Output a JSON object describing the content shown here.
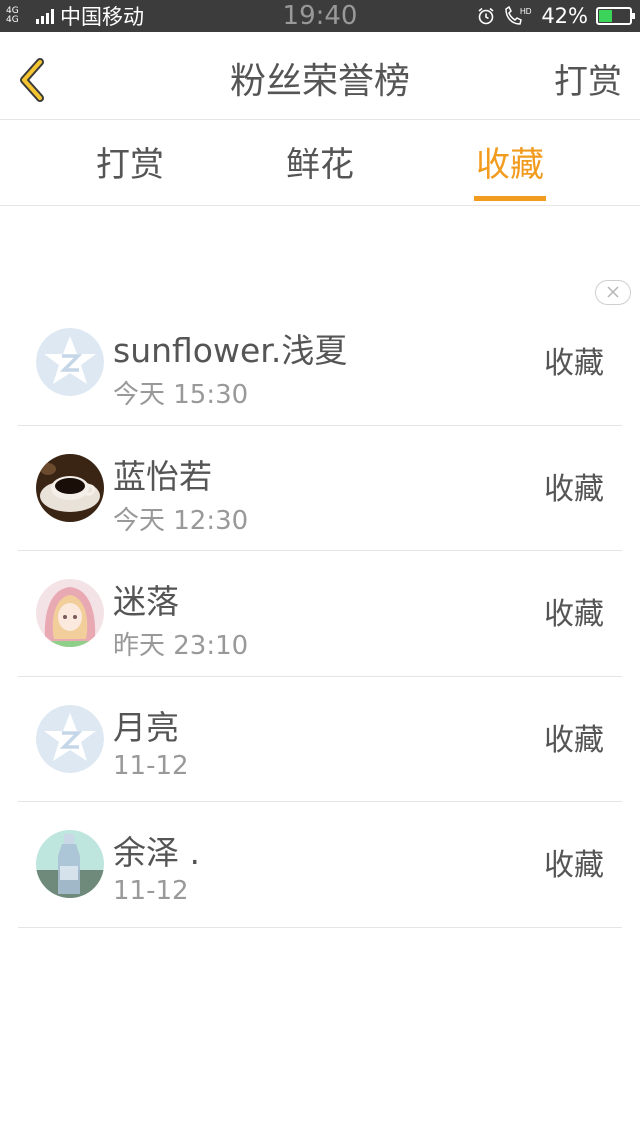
{
  "status_bar": {
    "network": "4G 4G",
    "carrier": "中国移动",
    "time": "19:40",
    "hd": "HD",
    "battery_percent": "42%",
    "battery_level": 0.42
  },
  "header": {
    "title": "粉丝荣誉榜",
    "action_label": "打赏"
  },
  "tabs": [
    {
      "label": "打赏",
      "active": false
    },
    {
      "label": "鲜花",
      "active": false
    },
    {
      "label": "收藏",
      "active": true
    }
  ],
  "accent_color": "#f29c1f",
  "fans": [
    {
      "name": "sunflower.浅夏",
      "time": "今天 15:30",
      "action": "收藏",
      "avatar": "qq-default-avatar"
    },
    {
      "name": "蓝怡若",
      "time": "今天 12:30",
      "action": "收藏",
      "avatar": "coffee-cup-avatar"
    },
    {
      "name": "迷落",
      "time": "昨天 23:10",
      "action": "收藏",
      "avatar": "anime-girl-avatar"
    },
    {
      "name": "月亮",
      "time": "11-12",
      "action": "收藏",
      "avatar": "qq-default-avatar"
    },
    {
      "name": "余泽 .",
      "time": "11-12",
      "action": "收藏",
      "avatar": "bottle-photo-avatar"
    }
  ]
}
